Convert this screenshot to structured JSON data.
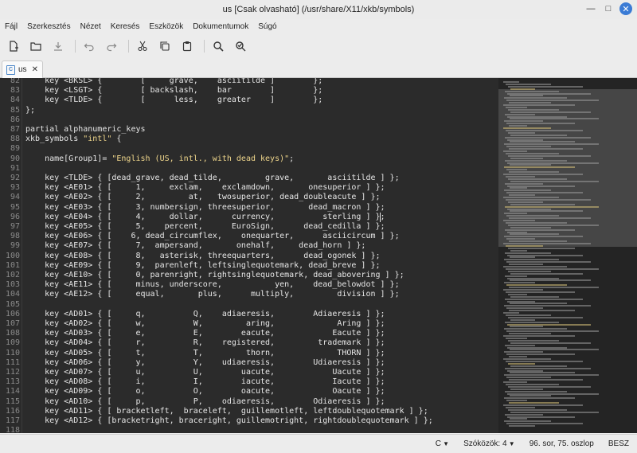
{
  "window": {
    "title": "us [Csak olvasható] (/usr/share/X11/xkb/symbols)"
  },
  "menu": [
    "Fájl",
    "Szerkesztés",
    "Nézet",
    "Keresés",
    "Eszközök",
    "Dokumentumok",
    "Súgó"
  ],
  "toolbar": {
    "icons": [
      "new-document-icon",
      "open-folder-icon",
      "save-icon",
      "undo-icon",
      "redo-icon",
      "cut-icon",
      "copy-icon",
      "paste-icon",
      "search-icon",
      "replace-icon"
    ]
  },
  "tab": {
    "label": "us",
    "icon_letter": "C",
    "close": "✕"
  },
  "editor": {
    "lines": [
      {
        "n": "82",
        "t": "    key <BKSL> {        [     grave,    asciitilde ]        };"
      },
      {
        "n": "83",
        "t": "    key <LSGT> {        [ backslash,    bar        ]        };"
      },
      {
        "n": "84",
        "t": "    key <TLDE> {        [      less,    greater    ]        };"
      },
      {
        "n": "85",
        "t": "};"
      },
      {
        "n": "86",
        "t": ""
      },
      {
        "n": "87",
        "t": "partial alphanumeric_keys"
      },
      {
        "n": "88",
        "t": "xkb_symbols \"intl\" {"
      },
      {
        "n": "89",
        "t": ""
      },
      {
        "n": "90",
        "t": "    name[Group1]= \"English (US, intl., with dead keys)\";"
      },
      {
        "n": "91",
        "t": ""
      },
      {
        "n": "92",
        "t": "    key <TLDE> { [dead_grave, dead_tilde,         grave,       asciitilde ] };"
      },
      {
        "n": "93",
        "t": "    key <AE01> { [     1,     exclam,    exclamdown,       onesuperior ] };"
      },
      {
        "n": "94",
        "t": "    key <AE02> { [     2,         at,   twosuperior, dead_doubleacute ] };"
      },
      {
        "n": "95",
        "t": "    key <AE03> { [     3, numbersign, threesuperior,       dead_macron ] };"
      },
      {
        "n": "96",
        "t": "    key <AE04> { [     4,     dollar,      currency,          sterling ] };"
      },
      {
        "n": "97",
        "t": "    key <AE05> { [     5,    percent,      EuroSign,      dead_cedilla ] };"
      },
      {
        "n": "98",
        "t": "    key <AE06> { [    6, dead_circumflex,    onequarter,      asciicircum ] };"
      },
      {
        "n": "99",
        "t": "    key <AE07> { [     7,  ampersand,       onehalf,     dead_horn ] };"
      },
      {
        "n": "100",
        "t": "    key <AE08> { [     8,   asterisk, threequarters,      dead_ogonek ] };"
      },
      {
        "n": "101",
        "t": "    key <AE09> { [     9,  parenleft, leftsinglequotemark, dead_breve ] };"
      },
      {
        "n": "102",
        "t": "    key <AE10> { [     0, parenright, rightsinglequotemark, dead_abovering ] };"
      },
      {
        "n": "103",
        "t": "    key <AE11> { [     minus, underscore,           yen,    dead_belowdot ] };"
      },
      {
        "n": "104",
        "t": "    key <AE12> { [     equal,       plus,      multiply,         division ] };"
      },
      {
        "n": "105",
        "t": ""
      },
      {
        "n": "106",
        "t": "    key <AD01> { [     q,          Q,    adiaeresis,        Adiaeresis ] };"
      },
      {
        "n": "107",
        "t": "    key <AD02> { [     w,          W,         aring,             Aring ] };"
      },
      {
        "n": "108",
        "t": "    key <AD03> { [     e,          E,        eacute,            Eacute ] };"
      },
      {
        "n": "109",
        "t": "    key <AD04> { [     r,          R,    registered,         trademark ] };"
      },
      {
        "n": "110",
        "t": "    key <AD05> { [     t,          T,         thorn,             THORN ] };"
      },
      {
        "n": "111",
        "t": "    key <AD06> { [     y,          Y,    udiaeresis,        Udiaeresis ] };"
      },
      {
        "n": "112",
        "t": "    key <AD07> { [     u,          U,        uacute,            Uacute ] };"
      },
      {
        "n": "113",
        "t": "    key <AD08> { [     i,          I,        iacute,            Iacute ] };"
      },
      {
        "n": "114",
        "t": "    key <AD09> { [     o,          O,        oacute,            Oacute ] };"
      },
      {
        "n": "115",
        "t": "    key <AD10> { [     p,          P,    odiaeresis,        Odiaeresis ] };"
      },
      {
        "n": "116",
        "t": "    key <AD11> { [ bracketleft,  braceleft,  guillemotleft, leftdoublequotemark ] };"
      },
      {
        "n": "117",
        "t": "    key <AD12> { [bracketright, braceright, guillemotright, rightdoublequotemark ] };"
      },
      {
        "n": "118",
        "t": ""
      }
    ]
  },
  "status": {
    "language": "C",
    "indent": "Szóközök: 4",
    "position": "96. sor, 75. oszlop",
    "mode": "BESZ"
  },
  "colors": {
    "editor_bg": "#2b2b2b",
    "string": "#f0d78c",
    "accent": "#3a7bd5"
  }
}
